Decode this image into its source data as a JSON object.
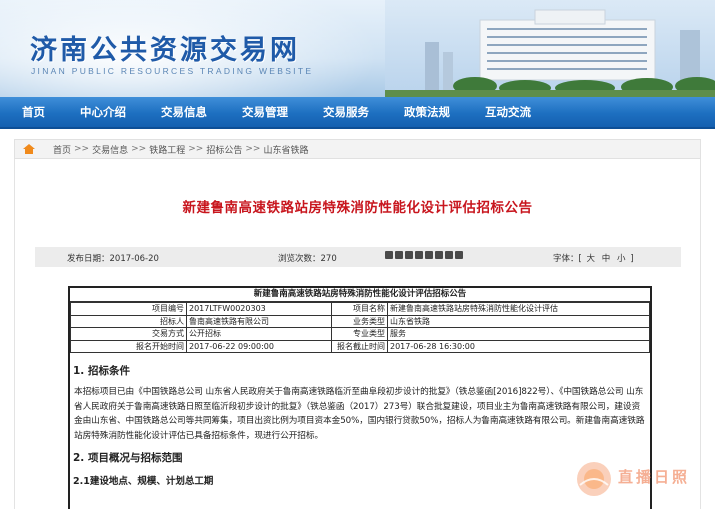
{
  "header": {
    "title": "济南公共资源交易网",
    "subtitle": "JINAN PUBLIC RESOURCES TRADING WEBSITE"
  },
  "nav": {
    "items": [
      {
        "label": "首页"
      },
      {
        "label": "中心介绍"
      },
      {
        "label": "交易信息"
      },
      {
        "label": "交易管理"
      },
      {
        "label": "交易服务"
      },
      {
        "label": "政策法规"
      },
      {
        "label": "互动交流"
      }
    ]
  },
  "breadcrumb": {
    "items": [
      "首页",
      "交易信息",
      "铁路工程",
      "招标公告",
      "山东省铁路"
    ],
    "separator": ">>"
  },
  "article": {
    "title": "新建鲁南高速铁路站房特殊消防性能化设计评估招标公告",
    "meta": {
      "date_label": "发布日期：",
      "date": "2017-06-20",
      "views_label": "浏览次数：",
      "views": "270",
      "font_label": "字体：",
      "font_open": "[",
      "font_close": "]",
      "font_large": "大",
      "font_medium": "中",
      "font_small": "小"
    }
  },
  "doc": {
    "heading": "新建鲁南高速铁路站房特殊消防性能化设计评估招标公告",
    "table": {
      "r1": {
        "l1": "项目编号",
        "v1": "2017LTFW0020303",
        "l2": "项目名称",
        "v2": "新建鲁南高速铁路站房特殊消防性能化设计评估"
      },
      "r2": {
        "l1": "招标人",
        "v1": "鲁南高速铁路有限公司",
        "l2": "业务类型",
        "v2": "山东省铁路"
      },
      "r3": {
        "l1": "交易方式",
        "v1": "公开招标",
        "l2": "专业类型",
        "v2": "服务"
      },
      "r4": {
        "l1": "报名开始时间",
        "v1": "2017-06-22 09:00:00",
        "l2": "报名截止时间",
        "v2": "2017-06-28 16:30:00"
      }
    },
    "section1": "1. 招标条件",
    "para1": "本招标项目已由《中国铁路总公司 山东省人民政府关于鲁南高速铁路临沂至曲阜段初步设计的批复》（铁总鉴函[2016]822号）、《中国铁路总公司 山东省人民政府关于鲁南高速铁路日照至临沂段初步设计的批复》（铁总鉴函（2017）273号）联合批复建设，项目业主为鲁南高速铁路有限公司，建设资金由山东省、中国铁路总公司等共同筹集，项目出资比例为项目资本金50%，国内银行贷款50%，招标人为鲁南高速铁路有限公司。新建鲁南高速铁路站房特殊消防性能化设计评估已具备招标条件，现进行公开招标。",
    "section2": "2. 项目概况与招标范围",
    "section3": "2.1建设地点、规模、计划总工期"
  },
  "watermark": {
    "text": "直播日照"
  }
}
